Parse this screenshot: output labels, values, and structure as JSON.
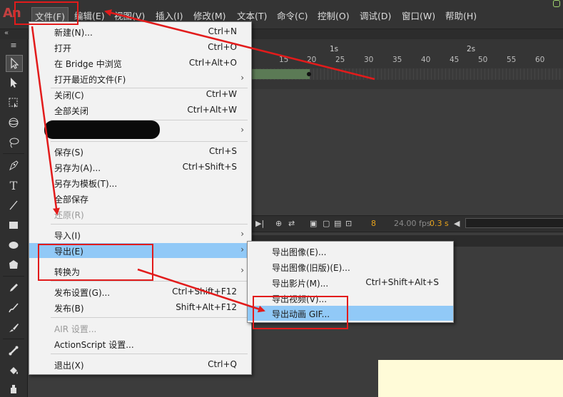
{
  "app": {
    "logo": "An"
  },
  "menubar": {
    "items": [
      "文件(F)",
      "编辑(E)",
      "视图(V)",
      "插入(I)",
      "修改(M)",
      "文本(T)",
      "命令(C)",
      "控制(O)",
      "调试(D)",
      "窗口(W)",
      "帮助(H)"
    ]
  },
  "second_bar": {
    "chevron": "«"
  },
  "toolbar": {
    "chevron": "«",
    "tools": [
      "selection-tool",
      "subselection-tool",
      "free-transform-tool",
      "3d-rotation-tool",
      "lasso-tool",
      "pen-tool",
      "text-tool",
      "line-tool",
      "rectangle-tool",
      "oval-tool",
      "polystar-tool",
      "pencil-tool",
      "brush-tool",
      "paint-brush-tool",
      "bone-tool",
      "paint-bucket-tool",
      "ink-bottle-tool"
    ],
    "text_tool_glyph": "T"
  },
  "timeline": {
    "seconds": [
      "1s",
      "2s"
    ],
    "frames": [
      "15",
      "20",
      "25",
      "30",
      "35",
      "40",
      "45",
      "50",
      "55",
      "60"
    ],
    "current_frame": "8",
    "fps": "24.00 fps",
    "elapsed": "0.3 s"
  },
  "file_menu": {
    "items": [
      {
        "label": "新建(N)...",
        "shortcut": "Ctrl+N"
      },
      {
        "label": "打开",
        "shortcut": "Ctrl+O"
      },
      {
        "label": "在 Bridge 中浏览",
        "shortcut": "Ctrl+Alt+O"
      },
      {
        "label": "打开最近的文件(F)",
        "submenu": "›"
      },
      {
        "label": "关闭(C)",
        "shortcut": "Ctrl+W"
      },
      {
        "label": "全部关闭",
        "shortcut": "Ctrl+Alt+W"
      },
      {
        "label": "",
        "submenu": "›",
        "redacted": true
      },
      {
        "label": "保存(S)",
        "shortcut": "Ctrl+S"
      },
      {
        "label": "另存为(A)...",
        "shortcut": "Ctrl+Shift+S"
      },
      {
        "label": "另存为模板(T)..."
      },
      {
        "label": "全部保存"
      },
      {
        "label": "还原(R)",
        "disabled": true
      },
      {
        "label": "导入(I)",
        "submenu": "›"
      },
      {
        "label": "导出(E)",
        "submenu": "›",
        "highlighted": true
      },
      {
        "label": "转换为",
        "submenu": "›"
      },
      {
        "label": "发布设置(G)...",
        "shortcut": "Ctrl+Shift+F12"
      },
      {
        "label": "发布(B)",
        "shortcut": "Shift+Alt+F12"
      },
      {
        "label": "AIR 设置...",
        "disabled": true
      },
      {
        "label": "ActionScript 设置..."
      },
      {
        "label": "退出(X)",
        "shortcut": "Ctrl+Q"
      }
    ]
  },
  "export_submenu": {
    "items": [
      {
        "label": "导出图像(E)..."
      },
      {
        "label": "导出图像(旧版)(E)..."
      },
      {
        "label": "导出影片(M)...",
        "shortcut": "Ctrl+Shift+Alt+S"
      },
      {
        "label": "导出视频(V)..."
      },
      {
        "label": "导出动画 GIF...",
        "highlighted": true
      }
    ]
  },
  "colors": {
    "highlight": "#91c9f7",
    "annotation_red": "#e21b1b",
    "menu_bg": "#f2f2f2",
    "chrome_dark": "#343434"
  }
}
